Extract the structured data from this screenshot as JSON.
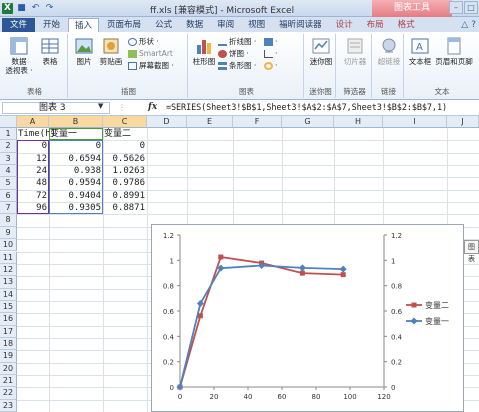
{
  "window": {
    "title": "ff.xls [兼容模式] - Microsoft Excel",
    "context_tab": "图表工具",
    "qat_icons": [
      "excel-logo-icon",
      "save-icon",
      "undo-icon",
      "redo-icon"
    ]
  },
  "ribbon": {
    "tabs": [
      "文件",
      "开始",
      "插入",
      "页面布局",
      "公式",
      "数据",
      "审阅",
      "视图",
      "福昕阅读器",
      "设计",
      "布局",
      "格式"
    ],
    "active_tab": "插入",
    "groups": {
      "tables": {
        "label": "表格",
        "pivot": "数据\n透视表 ·",
        "table": "表格"
      },
      "illustrations": {
        "label": "插图",
        "picture": "图片",
        "clipart": "剪贴画",
        "shapes": "形状 ·",
        "smartart": "SmartArt",
        "screenshot": "屏幕截图 ·"
      },
      "charts": {
        "label": "图表",
        "column": "柱形图",
        "line": "折线图 ·",
        "pie": "饼图 ·",
        "bar": "条形图 ·",
        "area": "·",
        "scatter": "·",
        "other": "·"
      },
      "sparklines": {
        "label": "迷你图",
        "btn": "迷你图"
      },
      "filter": {
        "label": "筛选器",
        "btn": "切片器"
      },
      "links": {
        "label": "链接",
        "btn": "超链接"
      },
      "text": {
        "label": "文本",
        "textbox": "文本框",
        "header_footer": "页眉和页脚"
      }
    }
  },
  "formula_bar": {
    "name_box": "图表 3",
    "fx": "fx",
    "formula": "=SERIES(Sheet3!$B$1,Sheet3!$A$2:$A$7,Sheet3!$B$2:$B$7,1)"
  },
  "sheet": {
    "columns": [
      "A",
      "B",
      "C",
      "D",
      "E",
      "F",
      "G",
      "H",
      "I",
      "J"
    ],
    "rows": [
      "1",
      "2",
      "3",
      "4",
      "5",
      "6",
      "7",
      "8",
      "9",
      "10",
      "11",
      "12",
      "13",
      "14",
      "15",
      "16",
      "17",
      "18",
      "19",
      "20",
      "21",
      "22",
      "23"
    ],
    "header_row": [
      "Time(h)",
      "变量一",
      "变量二"
    ],
    "data": [
      [
        "0",
        "0",
        "0"
      ],
      [
        "12",
        "0.6594",
        "0.5626"
      ],
      [
        "24",
        "0.938",
        "1.0263"
      ],
      [
        "48",
        "0.9594",
        "0.9786"
      ],
      [
        "72",
        "0.9404",
        "0.8991"
      ],
      [
        "96",
        "0.9305",
        "0.8871"
      ]
    ]
  },
  "chart_data": {
    "type": "scatter",
    "title": "",
    "xlabel": "",
    "ylabel": "",
    "x": [
      0,
      12,
      24,
      48,
      72,
      96
    ],
    "xlim": [
      0,
      120
    ],
    "xticks": [
      "0",
      "20",
      "40",
      "60",
      "80",
      "100",
      "120"
    ],
    "ylim": [
      0,
      1.2
    ],
    "yticks_left": [
      "0",
      "0.2",
      "0.4",
      "0.6",
      "0.8",
      "1",
      "1.2"
    ],
    "yticks_right": [
      "0",
      "0.2",
      "0.4",
      "0.6",
      "0.8",
      "1",
      "1.2"
    ],
    "grid": false,
    "legend_position": "right",
    "series": [
      {
        "name": "变量二",
        "values": [
          0,
          0.5626,
          1.0263,
          0.9786,
          0.8991,
          0.8871
        ],
        "color": "#c0504d",
        "marker": "square"
      },
      {
        "name": "变量一",
        "values": [
          0,
          0.6594,
          0.938,
          0.9594,
          0.9404,
          0.9305
        ],
        "color": "#4f81bd",
        "marker": "diamond"
      }
    ]
  },
  "side_handle": "图表"
}
